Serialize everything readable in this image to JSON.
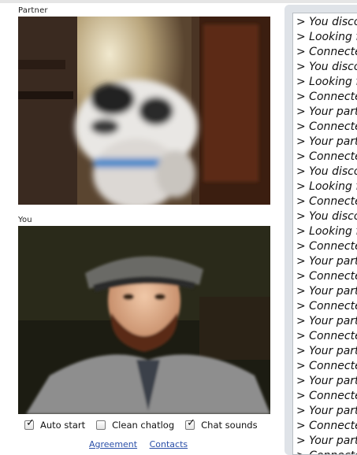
{
  "partner": {
    "label": "Partner"
  },
  "you": {
    "label": "You"
  },
  "controls": {
    "auto_start": {
      "label": "Auto start",
      "checked": true
    },
    "clean_chatlog": {
      "label": "Clean chatlog",
      "checked": false
    },
    "chat_sounds": {
      "label": "Chat sounds",
      "checked": true
    }
  },
  "links": {
    "agreement": "Agreement",
    "contacts": "Contacts"
  },
  "chat": {
    "lines": [
      "> You disco",
      "> Looking f",
      "> Connecte",
      "> You disco",
      "> Looking f",
      "> Connecte",
      "> Your part",
      "> Connecte",
      "> Your part",
      "> Connecte",
      "> You disco",
      "> Looking f",
      "> Connecte",
      "> You disco",
      "> Looking f",
      "> Connecte",
      "> Your part",
      "> Connecte",
      "> Your part",
      "> Connecte",
      "> Your part",
      "> Connecte",
      "> Your part",
      "> Connecte",
      "> Your part",
      "> Connecte",
      "> Your part",
      "> Connecte",
      "> Your part",
      "> Connecte"
    ]
  },
  "colors": {
    "link": "#2a4fa8",
    "panel_bg": "#dfe3e8",
    "log_border": "#b9bec4"
  }
}
